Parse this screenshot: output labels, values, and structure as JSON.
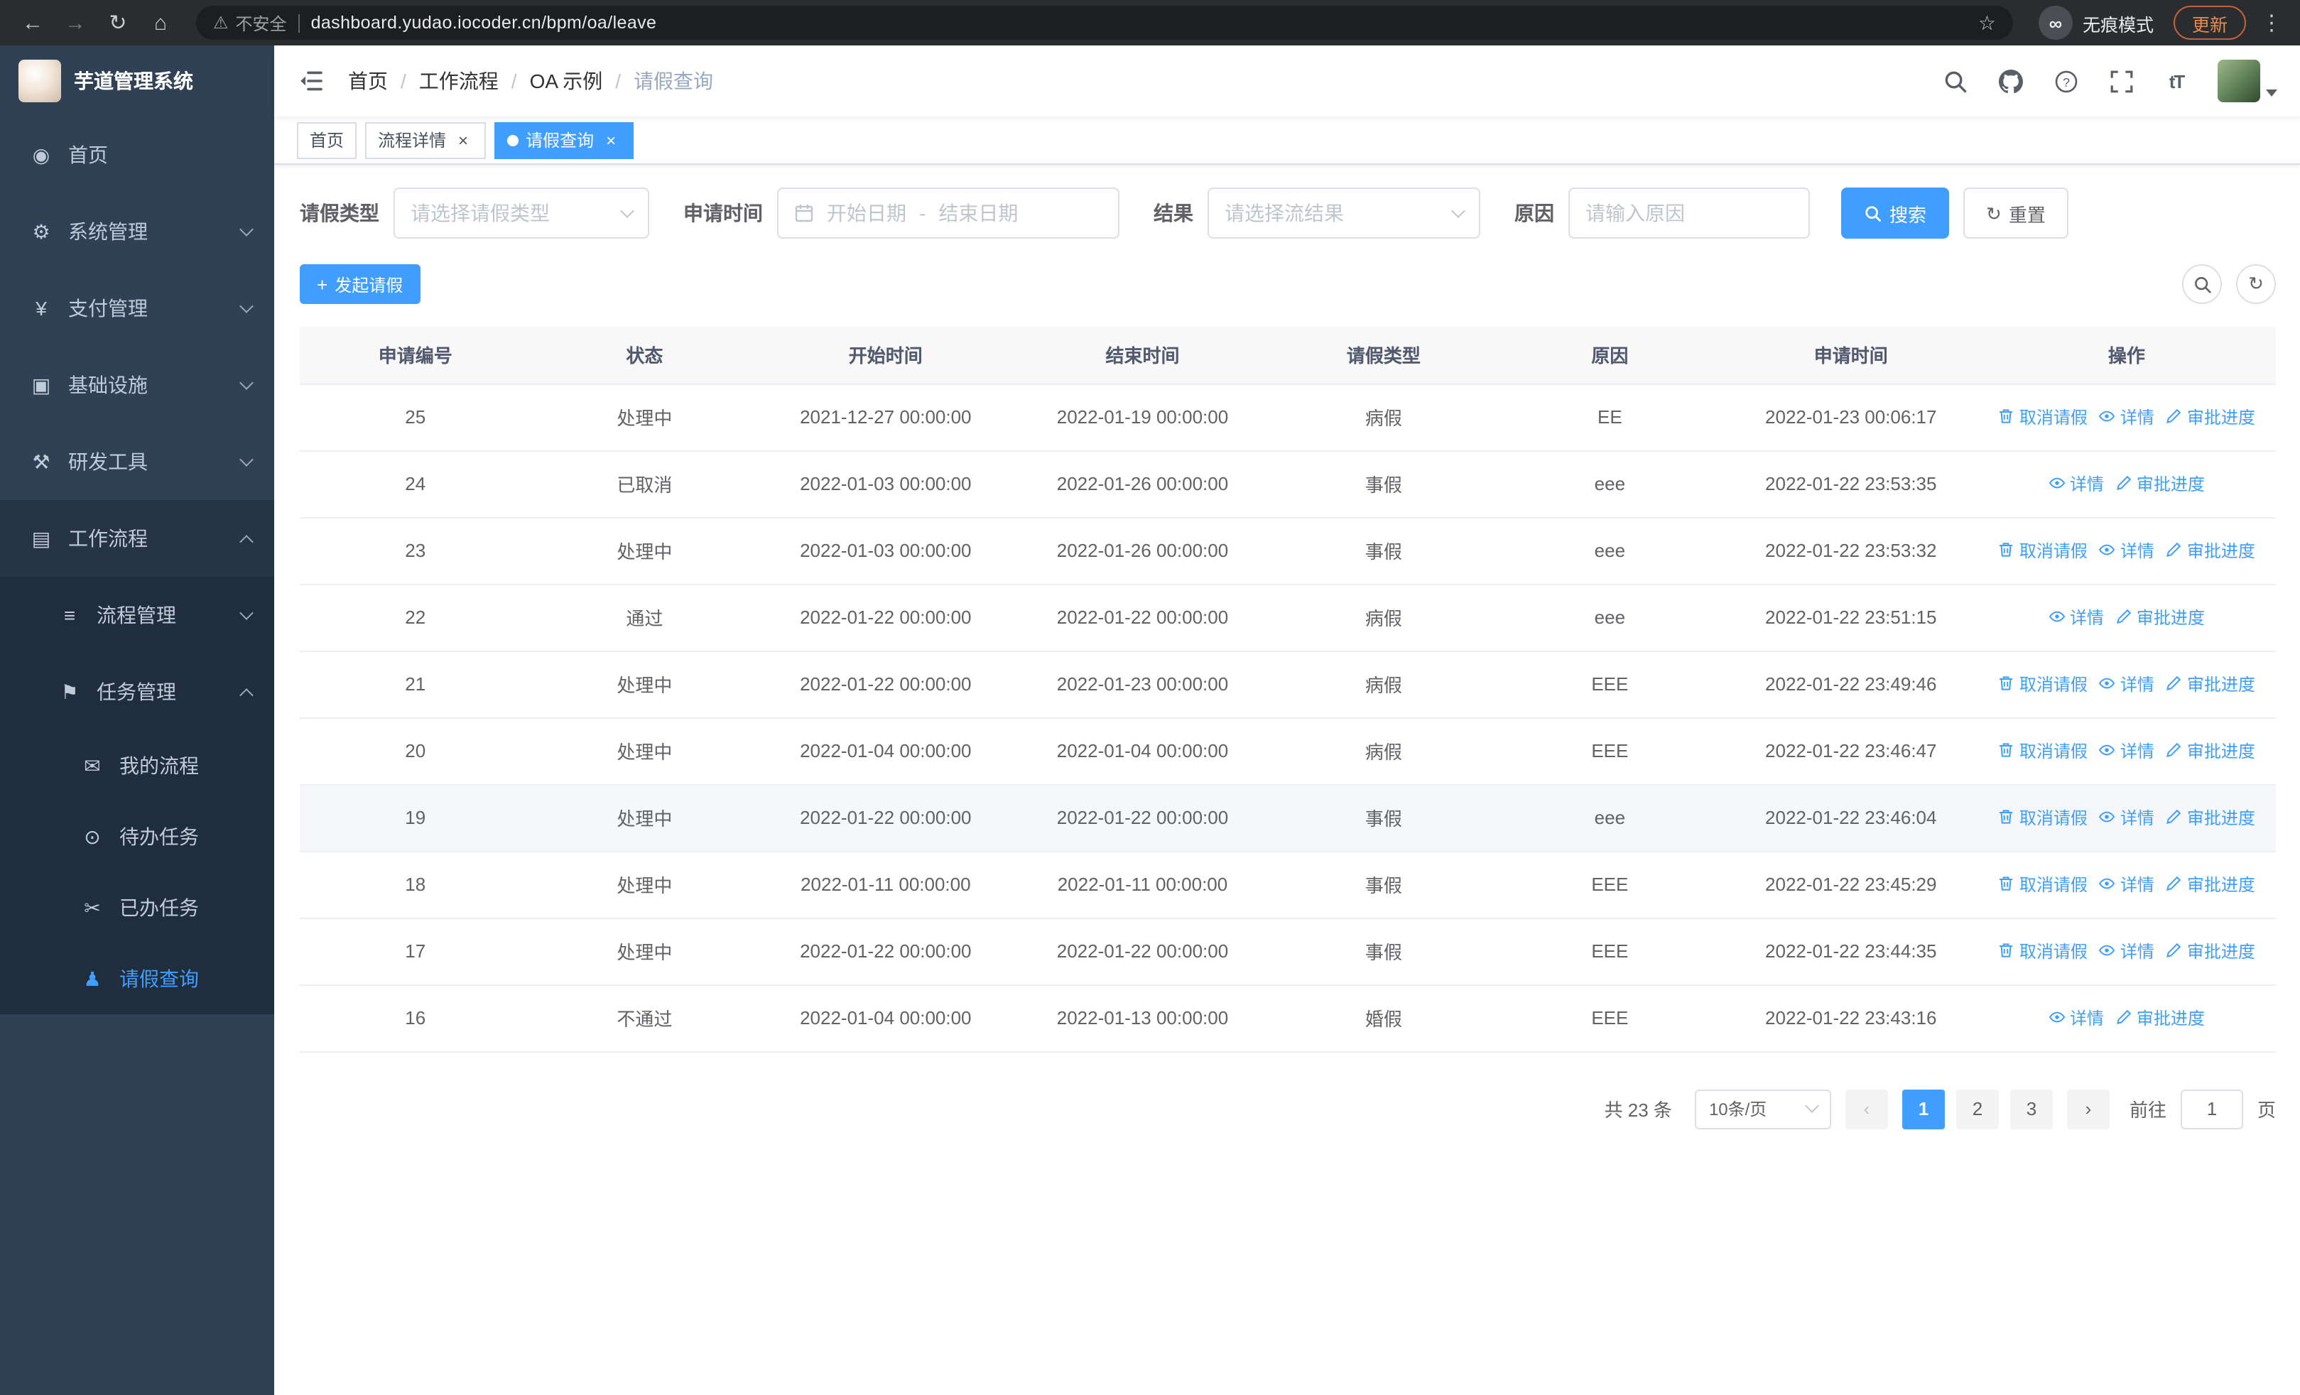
{
  "browser": {
    "security_label": "不安全",
    "url": "dashboard.yudao.iocoder.cn/bpm/oa/leave",
    "incognito_label": "无痕模式",
    "update_label": "更新"
  },
  "icons": {
    "back": "←",
    "forward": "→",
    "reload": "↻",
    "home": "⌂",
    "warning": "⚠",
    "star": "☆",
    "dots": "⋮",
    "incognito": "∞",
    "font_size": "tT",
    "plus": "+",
    "close": "×",
    "refresh": "↻",
    "prev": "‹",
    "next": "›"
  },
  "app": {
    "title": "芋道管理系统"
  },
  "sidebar": {
    "items": [
      {
        "id": "home",
        "icon": "dashboard-icon",
        "glyph": "◉",
        "label": "首页",
        "level": 1
      },
      {
        "id": "system",
        "icon": "gear-icon",
        "glyph": "⚙",
        "label": "系统管理",
        "level": 1,
        "chevron": "down"
      },
      {
        "id": "payment",
        "icon": "yen-icon",
        "glyph": "¥",
        "label": "支付管理",
        "level": 1,
        "chevron": "down"
      },
      {
        "id": "infra",
        "icon": "monitor-icon",
        "glyph": "▣",
        "label": "基础设施",
        "level": 1,
        "chevron": "down"
      },
      {
        "id": "devtools",
        "icon": "tools-icon",
        "glyph": "⚒",
        "label": "研发工具",
        "level": 1,
        "chevron": "down"
      },
      {
        "id": "workflow",
        "icon": "briefcase-icon",
        "glyph": "▤",
        "label": "工作流程",
        "level": 1,
        "chevron": "up",
        "open": true
      },
      {
        "id": "process-mgmt",
        "icon": "list-icon",
        "glyph": "≡",
        "label": "流程管理",
        "level": 2,
        "chevron": "down"
      },
      {
        "id": "task-mgmt",
        "icon": "flag-icon",
        "glyph": "⚑",
        "label": "任务管理",
        "level": 2,
        "chevron": "up",
        "open": true
      },
      {
        "id": "my-process",
        "icon": "message-icon",
        "glyph": "✉",
        "label": "我的流程",
        "level": 3
      },
      {
        "id": "todo-task",
        "icon": "eye-icon",
        "glyph": "⊙",
        "label": "待办任务",
        "level": 3
      },
      {
        "id": "done-task",
        "icon": "scissors-icon",
        "glyph": "✂",
        "label": "已办任务",
        "level": 3
      },
      {
        "id": "leave-query",
        "icon": "user-icon",
        "glyph": "♟",
        "label": "请假查询",
        "level": 3,
        "active": true
      }
    ]
  },
  "header": {
    "breadcrumb": [
      "首页",
      "工作流程",
      "OA 示例",
      "请假查询"
    ]
  },
  "tabs": [
    {
      "label": "首页",
      "closable": false,
      "active": false
    },
    {
      "label": "流程详情",
      "closable": true,
      "active": false
    },
    {
      "label": "请假查询",
      "closable": true,
      "active": true
    }
  ],
  "filters": {
    "leave_type": {
      "label": "请假类型",
      "placeholder": "请选择请假类型"
    },
    "apply_time": {
      "label": "申请时间",
      "start_placeholder": "开始日期",
      "separator": "-",
      "end_placeholder": "结束日期"
    },
    "result": {
      "label": "结果",
      "placeholder": "请选择流结果"
    },
    "reason": {
      "label": "原因",
      "placeholder": "请输入原因"
    },
    "search_label": "搜索",
    "reset_label": "重置"
  },
  "toolbar": {
    "create_label": "发起请假"
  },
  "table": {
    "columns": [
      "申请编号",
      "状态",
      "开始时间",
      "结束时间",
      "请假类型",
      "原因",
      "申请时间",
      "操作"
    ],
    "col_widths": [
      "11.7%",
      "11.5%",
      "12.9%",
      "13.1%",
      "11.3%",
      "11.6%",
      "12.8%",
      "15.1%"
    ],
    "action_labels": {
      "cancel": "取消请假",
      "detail": "详情",
      "progress": "审批进度"
    },
    "rows": [
      {
        "id": "25",
        "status": "处理中",
        "start": "2021-12-27 00:00:00",
        "end": "2022-01-19 00:00:00",
        "type": "病假",
        "reason": "EE",
        "applied": "2022-01-23 00:06:17",
        "actions": [
          "cancel",
          "detail",
          "progress"
        ],
        "highlight": false
      },
      {
        "id": "24",
        "status": "已取消",
        "start": "2022-01-03 00:00:00",
        "end": "2022-01-26 00:00:00",
        "type": "事假",
        "reason": "eee",
        "applied": "2022-01-22 23:53:35",
        "actions": [
          "detail",
          "progress"
        ],
        "highlight": false
      },
      {
        "id": "23",
        "status": "处理中",
        "start": "2022-01-03 00:00:00",
        "end": "2022-01-26 00:00:00",
        "type": "事假",
        "reason": "eee",
        "applied": "2022-01-22 23:53:32",
        "actions": [
          "cancel",
          "detail",
          "progress"
        ],
        "highlight": false
      },
      {
        "id": "22",
        "status": "通过",
        "start": "2022-01-22 00:00:00",
        "end": "2022-01-22 00:00:00",
        "type": "病假",
        "reason": "eee",
        "applied": "2022-01-22 23:51:15",
        "actions": [
          "detail",
          "progress"
        ],
        "highlight": false
      },
      {
        "id": "21",
        "status": "处理中",
        "start": "2022-01-22 00:00:00",
        "end": "2022-01-23 00:00:00",
        "type": "病假",
        "reason": "EEE",
        "applied": "2022-01-22 23:49:46",
        "actions": [
          "cancel",
          "detail",
          "progress"
        ],
        "highlight": false
      },
      {
        "id": "20",
        "status": "处理中",
        "start": "2022-01-04 00:00:00",
        "end": "2022-01-04 00:00:00",
        "type": "病假",
        "reason": "EEE",
        "applied": "2022-01-22 23:46:47",
        "actions": [
          "cancel",
          "detail",
          "progress"
        ],
        "highlight": false
      },
      {
        "id": "19",
        "status": "处理中",
        "start": "2022-01-22 00:00:00",
        "end": "2022-01-22 00:00:00",
        "type": "事假",
        "reason": "eee",
        "applied": "2022-01-22 23:46:04",
        "actions": [
          "cancel",
          "detail",
          "progress"
        ],
        "highlight": true
      },
      {
        "id": "18",
        "status": "处理中",
        "start": "2022-01-11 00:00:00",
        "end": "2022-01-11 00:00:00",
        "type": "事假",
        "reason": "EEE",
        "applied": "2022-01-22 23:45:29",
        "actions": [
          "cancel",
          "detail",
          "progress"
        ],
        "highlight": false
      },
      {
        "id": "17",
        "status": "处理中",
        "start": "2022-01-22 00:00:00",
        "end": "2022-01-22 00:00:00",
        "type": "事假",
        "reason": "EEE",
        "applied": "2022-01-22 23:44:35",
        "actions": [
          "cancel",
          "detail",
          "progress"
        ],
        "highlight": false
      },
      {
        "id": "16",
        "status": "不通过",
        "start": "2022-01-04 00:00:00",
        "end": "2022-01-13 00:00:00",
        "type": "婚假",
        "reason": "EEE",
        "applied": "2022-01-22 23:43:16",
        "actions": [
          "detail",
          "progress"
        ],
        "highlight": false
      }
    ]
  },
  "pagination": {
    "total_label": "共 23 条",
    "page_size": "10条/页",
    "pages": [
      "1",
      "2",
      "3"
    ],
    "active_page": "1",
    "goto_label": "前往",
    "goto_value": "1",
    "page_unit_label": "页"
  }
}
